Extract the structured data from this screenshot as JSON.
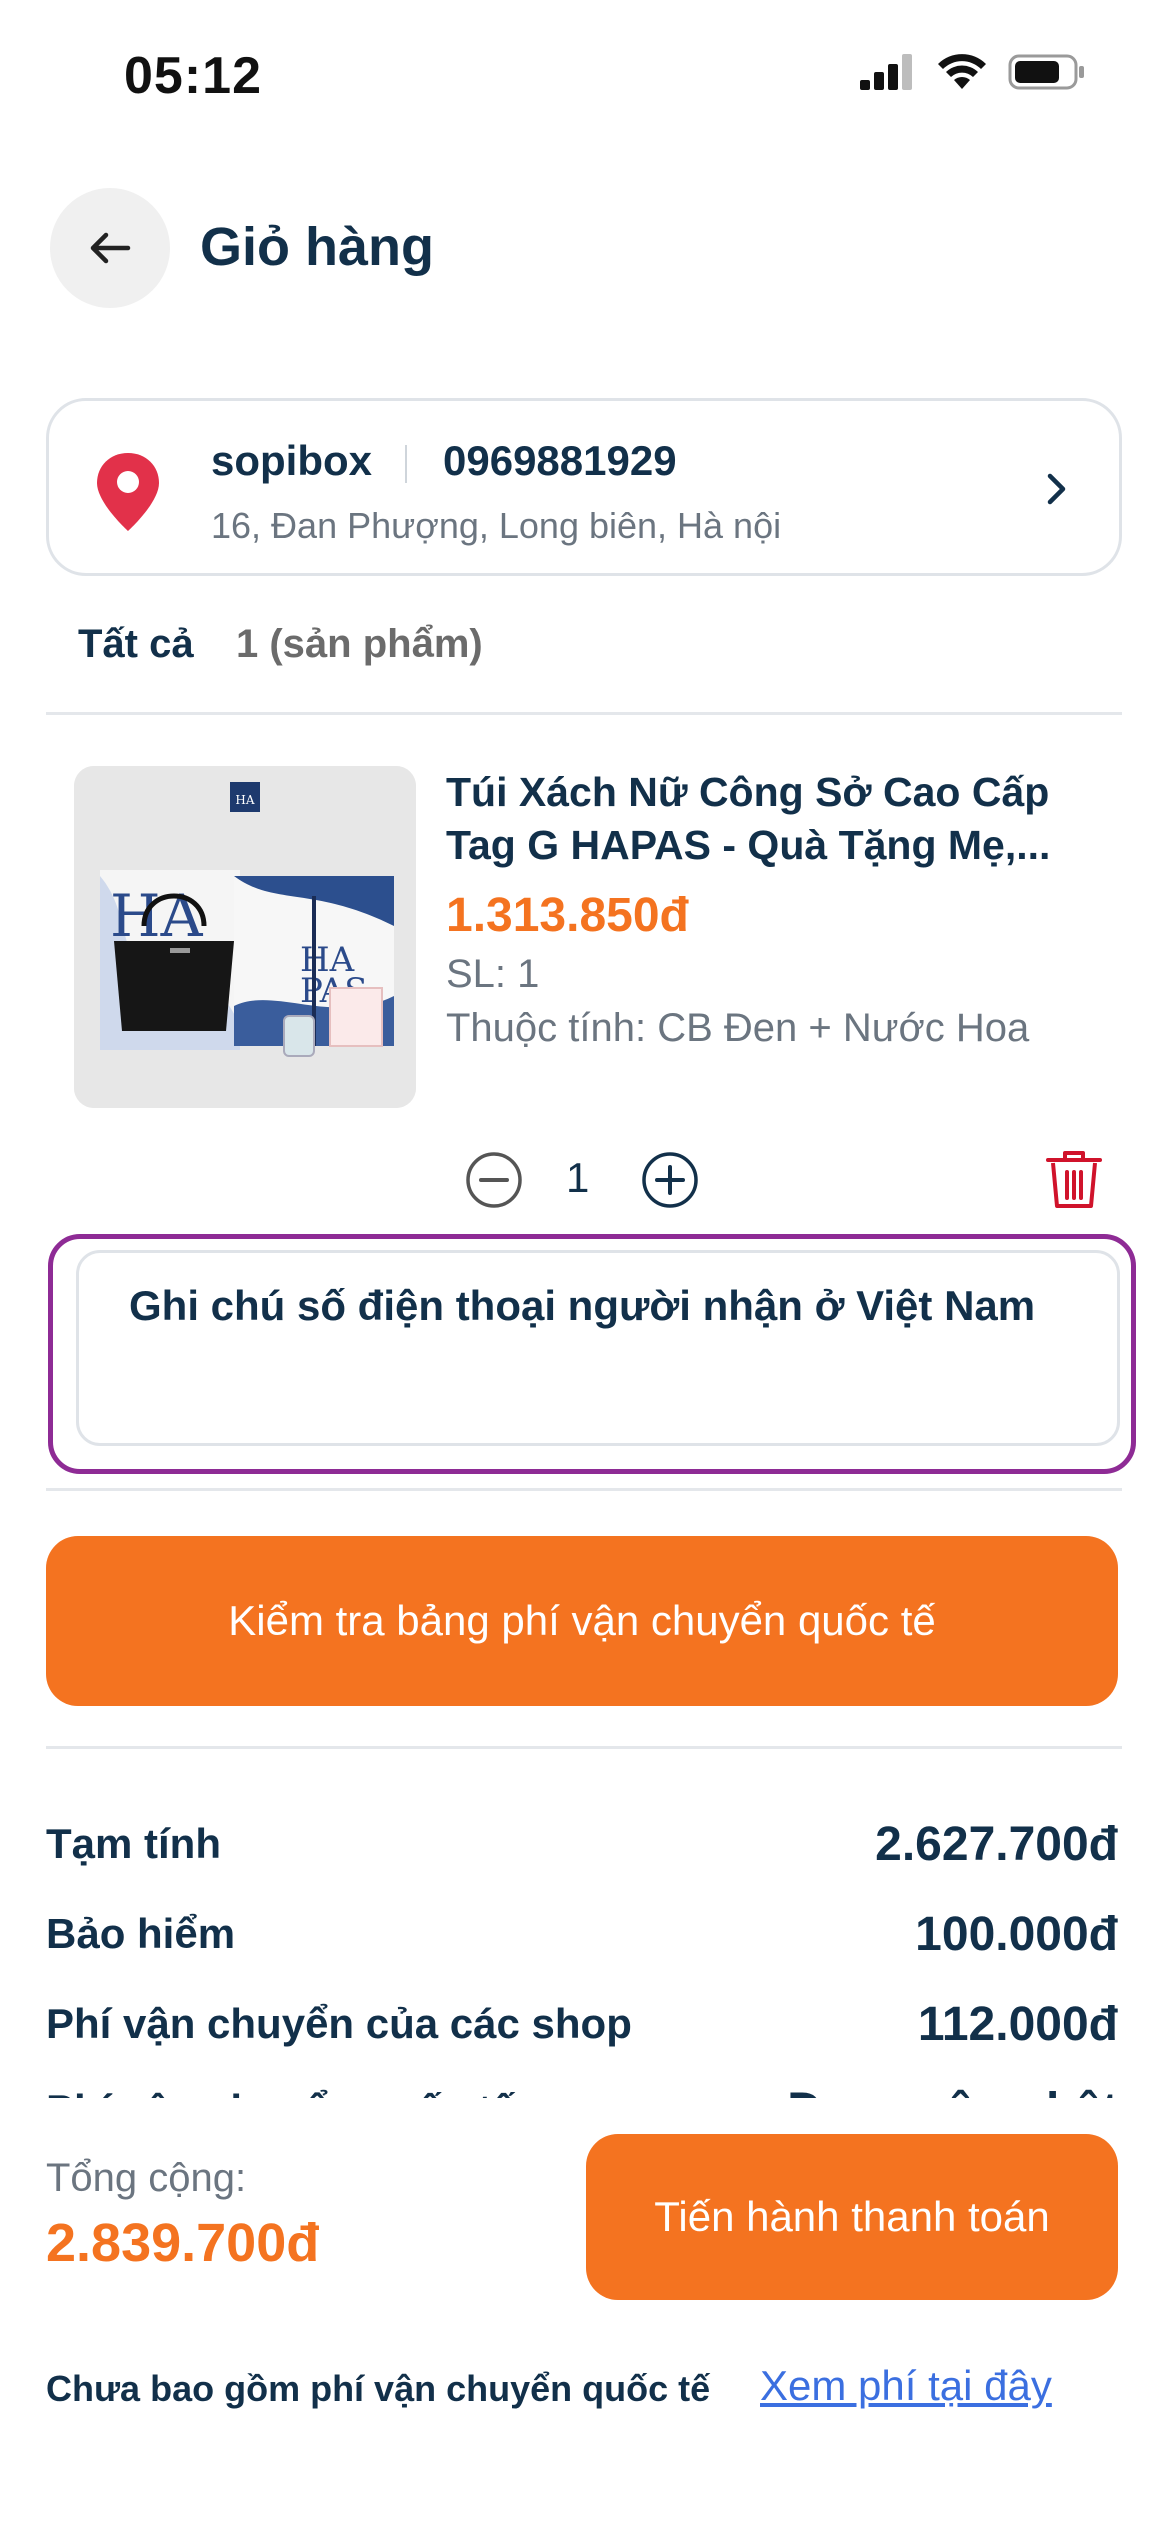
{
  "status_bar": {
    "time": "05:12"
  },
  "header": {
    "title": "Giỏ hàng"
  },
  "address": {
    "name": "sopibox",
    "phone": "0969881929",
    "line": "16, Đan Phượng, Long biên, Hà nội"
  },
  "cart": {
    "all_label": "Tất cả",
    "count": "1 (sản phẩm)",
    "item": {
      "title": "Túi Xách Nữ Công Sở Cao Cấp Tag G HAPAS - Quà Tặng Mẹ,...",
      "price": "1.313.850đ",
      "qty_label": "SL: 1",
      "attribute": "Thuộc tính: CB Đen + Nước Hoa",
      "stepper_value": "1",
      "image_brand": "HAPAS"
    }
  },
  "note": {
    "text": "Ghi chú số điện thoại người nhận ở Việt Nam"
  },
  "shipping_button": {
    "label": "Kiểm tra bảng phí vận chuyển quốc tế"
  },
  "summary": [
    {
      "label": "Tạm tính",
      "value": "2.627.700đ"
    },
    {
      "label": "Bảo hiểm",
      "value": "100.000đ"
    },
    {
      "label": "Phí vận chuyển của các shop",
      "value": "112.000đ"
    },
    {
      "label": "Phí vận chuyển quốc tế",
      "value": "Đang cập nhật"
    }
  ],
  "total": {
    "label": "Tổng cộng:",
    "value": "2.839.700đ"
  },
  "checkout_button": {
    "label": "Tiến hành thanh toán"
  },
  "footer": {
    "note": "Chưa bao gồm phí vận chuyển quốc tế",
    "link": "Xem phí tại đây"
  },
  "colors": {
    "accent": "#f47320",
    "text": "#12304a",
    "note_outline": "#8e2b95",
    "pin": "#e2314a",
    "link": "#3b6fe0"
  }
}
